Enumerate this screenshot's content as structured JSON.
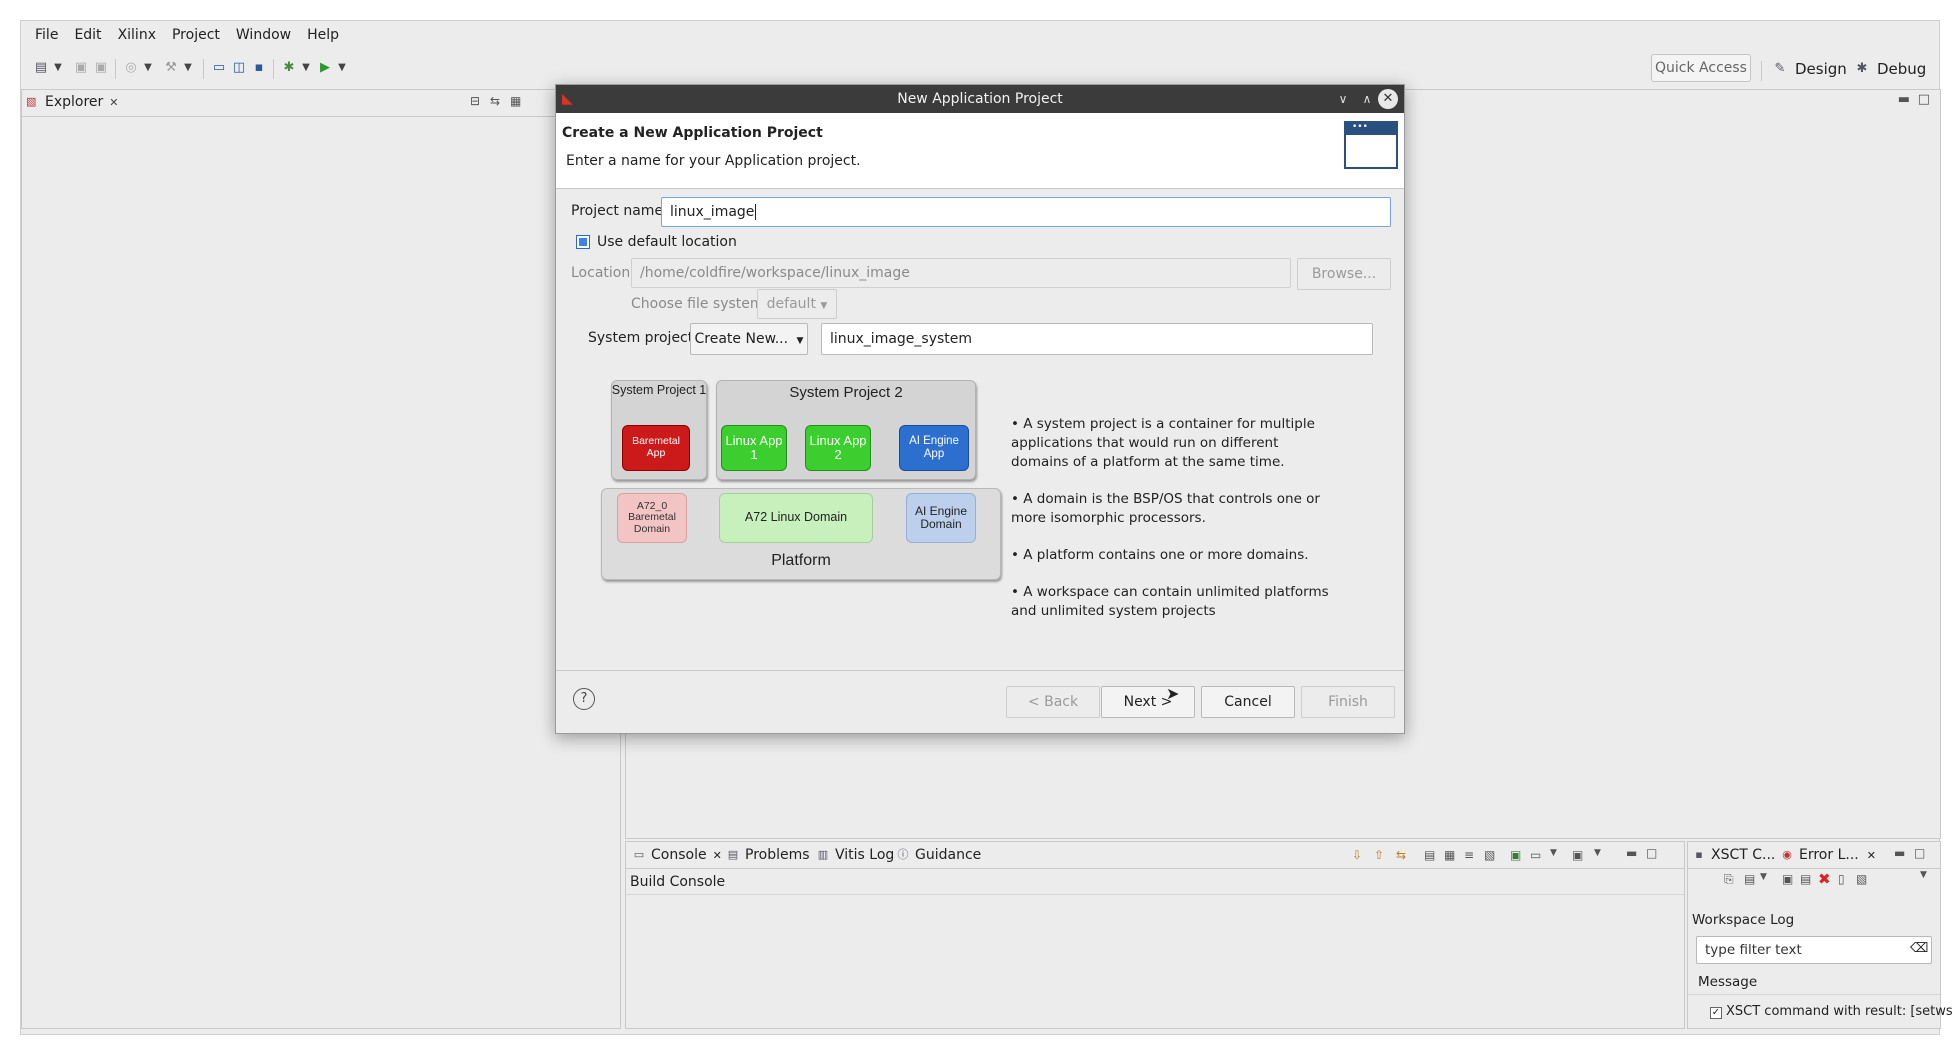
{
  "menu": [
    "File",
    "Edit",
    "Xilinx",
    "Project",
    "Window",
    "Help"
  ],
  "toolbar": {
    "quick_access": "Quick Access"
  },
  "perspectives": {
    "design": "Design",
    "debug": "Debug"
  },
  "explorer": {
    "tab_label": "Explorer"
  },
  "dialog": {
    "title": "New Application Project",
    "heading": "Create a New Application Project",
    "subheading": "Enter a name for your Application project.",
    "project_name_label": "Project name:",
    "project_name_value": "linux_image",
    "use_default_location_label": "Use default location",
    "use_default_location_checked": true,
    "location_label": "Location:",
    "location_value": "/home/coldfire/workspace/linux_image",
    "browse_label": "Browse...",
    "file_system_label": "Choose file system:",
    "file_system_value": "default",
    "system_project_label": "System project:",
    "system_project_mode": "Create New...",
    "system_project_value": "linux_image_system",
    "diagram": {
      "system_project_1": "System Project 1",
      "system_project_2": "System Project 2",
      "baremetal_app": "Baremetal App",
      "linux_app_1": "Linux App 1",
      "linux_app_2": "Linux App 2",
      "ai_engine_app": "AI Engine App",
      "a72_baremetal_domain": "A72_0 Baremetal Domain",
      "a72_linux_domain": "A72 Linux Domain",
      "ai_engine_domain": "AI Engine Domain",
      "platform": "Platform"
    },
    "bullets": [
      "• A system project is a container for multiple applications that would run on different domains of a platform at the same time.",
      "• A domain is the BSP/OS that controls one or more isomorphic processors.",
      "• A platform contains one or more domains.",
      "• A workspace can contain unlimited platforms and unlimited system projects"
    ],
    "buttons": {
      "back": "< Back",
      "next": "Next >",
      "cancel": "Cancel",
      "finish": "Finish"
    }
  },
  "console_panel": {
    "tabs": [
      "Console",
      "Problems",
      "Vitis Log",
      "Guidance"
    ],
    "content_title": "Build Console"
  },
  "right_panel": {
    "tabs": [
      "XSCT C...",
      "Error L..."
    ],
    "workspace_log": "Workspace Log",
    "filter_placeholder": "type filter text",
    "column_message": "Message",
    "row_text": "XSCT command with result: [setws"
  }
}
